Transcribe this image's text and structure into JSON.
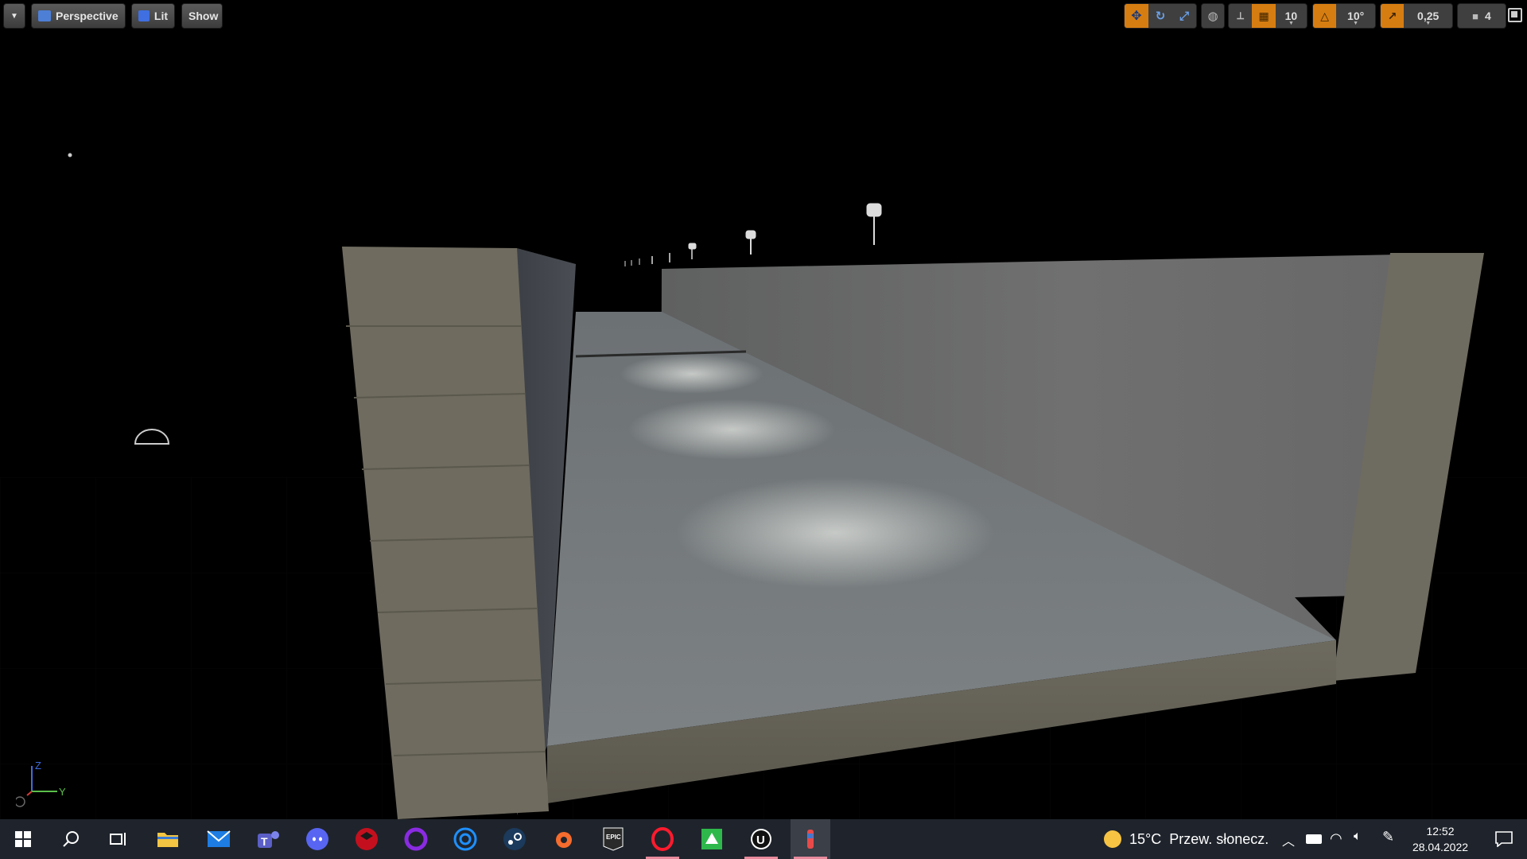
{
  "viewport": {
    "menu_icon": "chevron-down-icon",
    "perspective_label": "Perspective",
    "lit_label": "Lit",
    "show_label": "Show",
    "axis_z": "Z",
    "axis_y": "Y",
    "colors": {
      "accent": "#d67d12",
      "toolbar_bg": "#3f3f3f"
    }
  },
  "toolbar_right": {
    "grid_snap_value": "10",
    "rotation_snap_value": "10°",
    "scale_snap_value": "0,25",
    "camera_speed_value": "4"
  },
  "taskbar": {
    "apps": [
      {
        "name": "start",
        "icon": "windows-icon"
      },
      {
        "name": "search",
        "icon": "search-icon"
      },
      {
        "name": "task-view",
        "icon": "task-view-icon"
      },
      {
        "name": "file-explorer",
        "icon": "folder-icon"
      },
      {
        "name": "mail",
        "icon": "mail-icon"
      },
      {
        "name": "teams",
        "icon": "teams-icon"
      },
      {
        "name": "discord",
        "icon": "discord-icon"
      },
      {
        "name": "app-red",
        "icon": "red-cube-icon"
      },
      {
        "name": "app-ring",
        "icon": "ring-icon"
      },
      {
        "name": "ubisoft",
        "icon": "ubisoft-icon"
      },
      {
        "name": "steam",
        "icon": "steam-icon"
      },
      {
        "name": "origin",
        "icon": "origin-icon"
      },
      {
        "name": "epic-games",
        "icon": "epic-games-icon"
      },
      {
        "name": "opera",
        "icon": "opera-icon"
      },
      {
        "name": "app-green",
        "icon": "green-app-icon"
      },
      {
        "name": "unreal-engine",
        "icon": "unreal-icon"
      },
      {
        "name": "app-current",
        "icon": "paint-app-icon"
      }
    ],
    "weather": {
      "temperature": "15°C",
      "condition": "Przew. słonecz."
    },
    "clock": {
      "time": "12:52",
      "date": "28.04.2022"
    }
  }
}
